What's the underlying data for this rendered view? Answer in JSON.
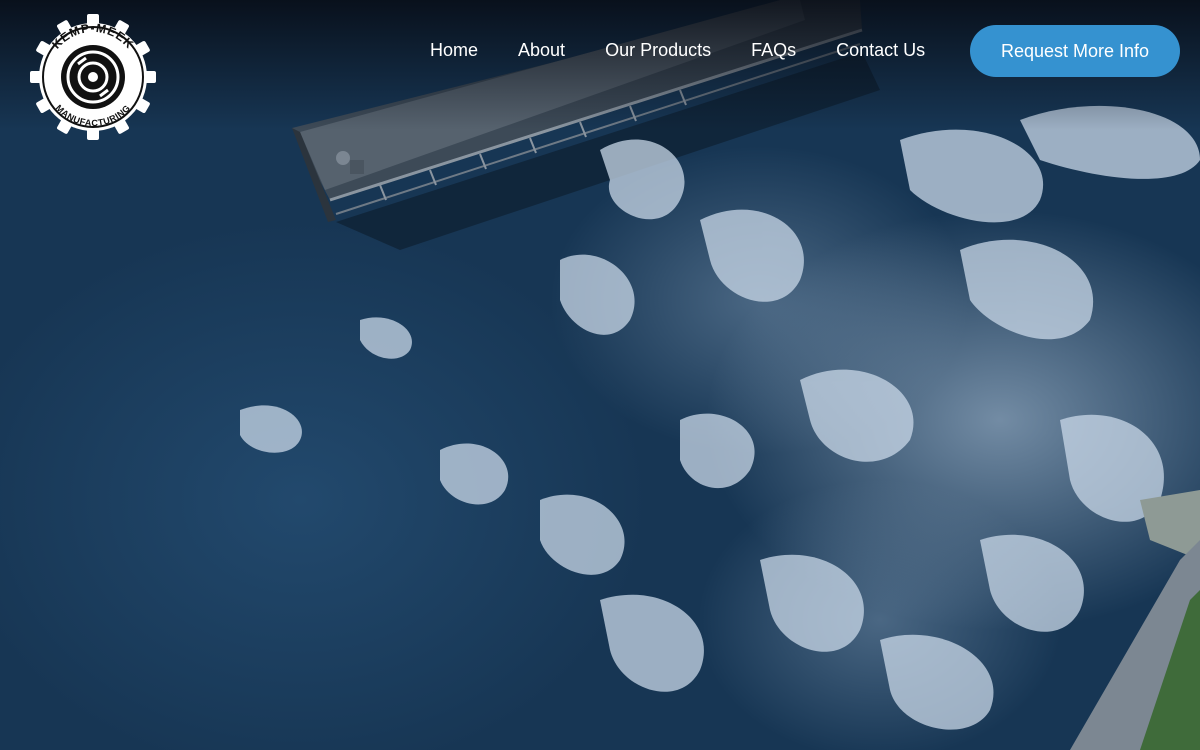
{
  "brand": {
    "logo_top": "KEMP-MEEK",
    "logo_bottom": "MANUFACTURING"
  },
  "nav": {
    "items": [
      {
        "label": "Home"
      },
      {
        "label": "About"
      },
      {
        "label": "Our Products"
      },
      {
        "label": "FAQs"
      },
      {
        "label": "Contact Us"
      }
    ],
    "cta_label": "Request More Info"
  },
  "colors": {
    "accent": "#3592d0",
    "water_dark": "#173654",
    "water_mid": "#1d4264",
    "foam": "#c9d8e8"
  }
}
